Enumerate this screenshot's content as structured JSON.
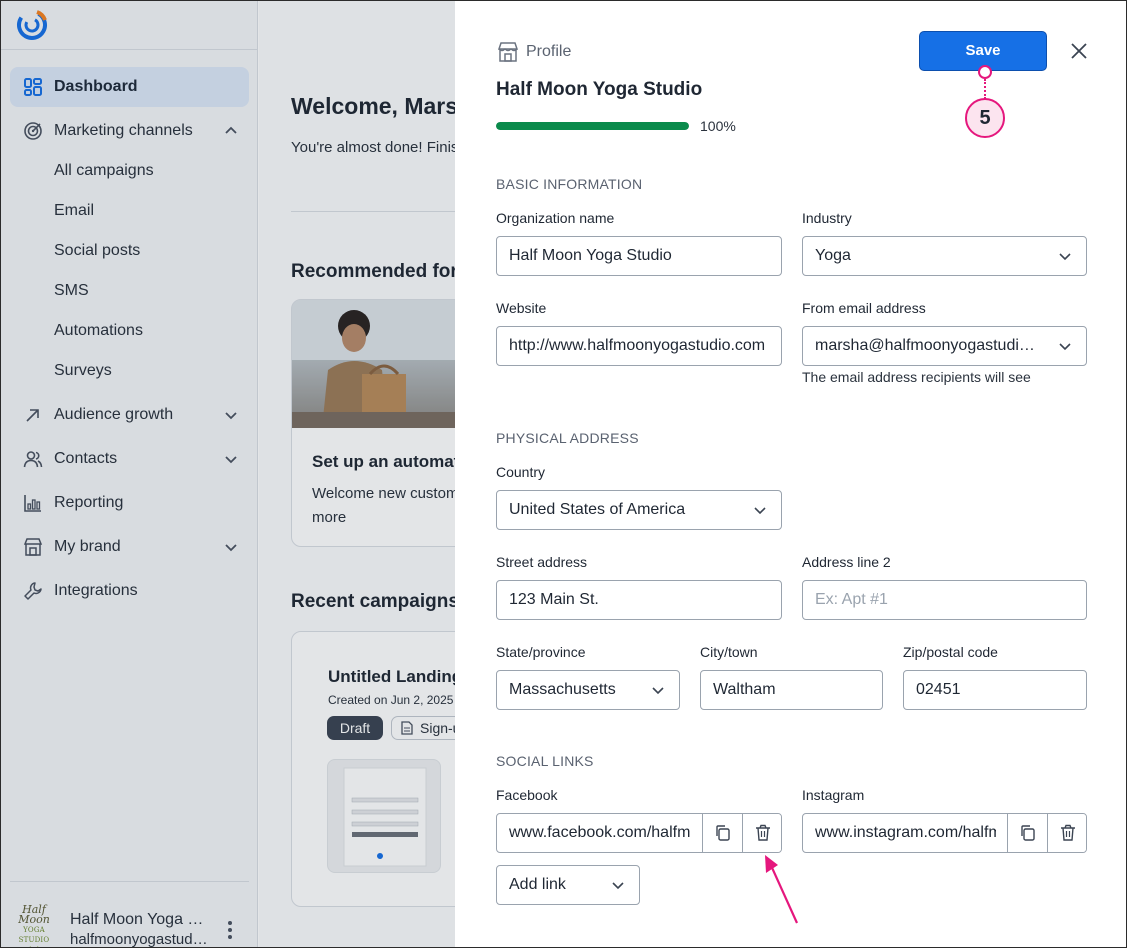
{
  "sidebar": {
    "items": [
      {
        "label": "Dashboard",
        "icon": "dashboard-icon",
        "active": true
      },
      {
        "label": "Marketing channels",
        "icon": "target-icon",
        "expanded": true
      },
      {
        "label": "Audience growth",
        "icon": "arrow-up-right-icon"
      },
      {
        "label": "Contacts",
        "icon": "contacts-icon"
      },
      {
        "label": "Reporting",
        "icon": "chart-icon"
      },
      {
        "label": "My brand",
        "icon": "store-icon"
      },
      {
        "label": "Integrations",
        "icon": "wrench-icon"
      }
    ],
    "subitems": [
      "All campaigns",
      "Email",
      "Social posts",
      "SMS",
      "Automations",
      "Surveys"
    ],
    "brand": {
      "avatar_line1": "Half Moon",
      "avatar_line2": "YOGA STUDIO",
      "name": "Half Moon Yoga Studio",
      "email": "halfmoonyogastudio.com"
    }
  },
  "main": {
    "welcome": "Welcome, Marsha",
    "subtitle": "You're almost done! Finish setting up",
    "recommended": "Recommended for you",
    "card_title": "Set up an automation",
    "card_text": "Welcome new customers and more",
    "recent": "Recent campaigns",
    "campaign_title": "Untitled Landing Page",
    "campaign_date": "Created on Jun 2, 2025",
    "draft": "Draft",
    "type": "Sign-up"
  },
  "panel": {
    "header_label": "Profile",
    "save_label": "Save",
    "step": "5",
    "title": "Half Moon Yoga Studio",
    "progress_percent": 100,
    "progress_text": "100%",
    "basic": {
      "section": "BASIC INFORMATION",
      "org_label": "Organization name",
      "org_value": "Half Moon Yoga Studio",
      "industry_label": "Industry",
      "industry_value": "Yoga",
      "website_label": "Website",
      "website_value": "http://www.halfmoonyogastudio.com",
      "from_label": "From email address",
      "from_value": "marsha@halfmoonyogastudi…",
      "from_helper": "The email address recipients will see"
    },
    "address": {
      "section": "PHYSICAL ADDRESS",
      "country_label": "Country",
      "country_value": "United States of America",
      "street_label": "Street address",
      "street_value": "123 Main St.",
      "line2_label": "Address line 2",
      "line2_placeholder": "Ex: Apt #1",
      "state_label": "State/province",
      "state_value": "Massachusetts",
      "city_label": "City/town",
      "city_value": "Waltham",
      "zip_label": "Zip/postal code",
      "zip_value": "02451"
    },
    "social": {
      "section": "SOCIAL LINKS",
      "facebook_label": "Facebook",
      "facebook_value": "www.facebook.com/halfmoonyoga",
      "instagram_label": "Instagram",
      "instagram_value": "www.instagram.com/halfmoonyoga",
      "add_link": "Add link"
    }
  },
  "colors": {
    "primary": "#1670e6",
    "progress": "#0a8a4b",
    "annotation": "#e5177d"
  }
}
